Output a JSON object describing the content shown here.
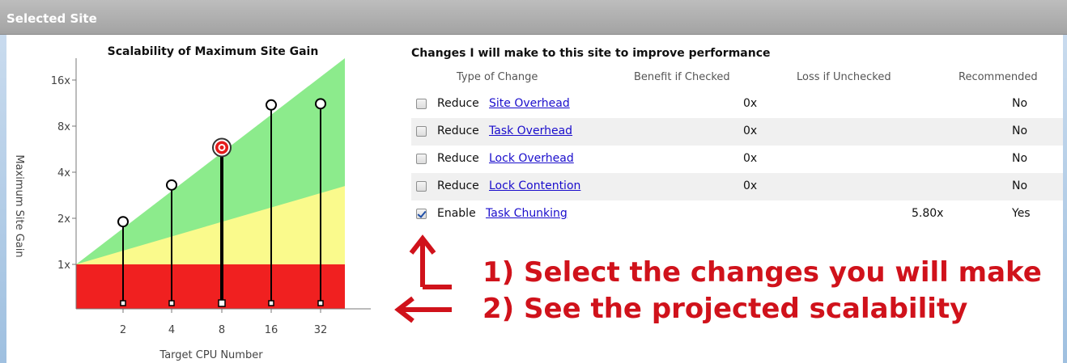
{
  "window": {
    "title": "Selected Site"
  },
  "chart": {
    "title": "Scalability of Maximum Site Gain",
    "ylabel": "Maximum Site Gain",
    "xlabel": "Target CPU Number"
  },
  "chart_data": {
    "type": "scatter",
    "title": "Scalability of Maximum Site Gain",
    "xlabel": "Target CPU Number",
    "ylabel": "Maximum Site Gain",
    "yscale": "log2",
    "x_categories": [
      "2",
      "4",
      "8",
      "16",
      "32"
    ],
    "y_ticks": [
      "1x",
      "2x",
      "4x",
      "8x",
      "16x"
    ],
    "y_tick_values": [
      1,
      2,
      4,
      8,
      16
    ],
    "points": [
      {
        "x": "2",
        "y": 1.9
      },
      {
        "x": "4",
        "y": 3.3
      },
      {
        "x": "8",
        "y": 5.8,
        "target": true
      },
      {
        "x": "16",
        "y": 11.0
      },
      {
        "x": "32",
        "y": 11.2
      }
    ],
    "regions": [
      {
        "name": "red",
        "color": "#f02020"
      },
      {
        "name": "yellow",
        "color": "#fafa8c"
      },
      {
        "name": "green",
        "color": "#8ceb8c"
      }
    ]
  },
  "changes": {
    "title": "Changes I will make to this site to improve performance",
    "headers": {
      "type": "Type of Change",
      "benefit": "Benefit if Checked",
      "loss": "Loss if Unchecked",
      "recommended": "Recommended"
    },
    "rows": [
      {
        "verb": "Reduce",
        "link": "Site Overhead",
        "benefit": "0x",
        "loss": "",
        "recommended": "No",
        "checked": false
      },
      {
        "verb": "Reduce",
        "link": "Task Overhead",
        "benefit": "0x",
        "loss": "",
        "recommended": "No",
        "checked": false
      },
      {
        "verb": "Reduce",
        "link": "Lock Overhead",
        "benefit": "0x",
        "loss": "",
        "recommended": "No",
        "checked": false
      },
      {
        "verb": "Reduce",
        "link": "Lock Contention",
        "benefit": "0x",
        "loss": "",
        "recommended": "No",
        "checked": false
      },
      {
        "verb": "Enable",
        "link": "Task Chunking",
        "benefit": "",
        "loss": "5.80x",
        "recommended": "Yes",
        "checked": true
      }
    ]
  },
  "annotations": {
    "step1": "1) Select the changes you will make",
    "step2": "2) See the projected scalability"
  },
  "colors": {
    "annotation": "#d0121b",
    "link": "#1a0dcc",
    "titlebar": "#b0b0b0"
  }
}
